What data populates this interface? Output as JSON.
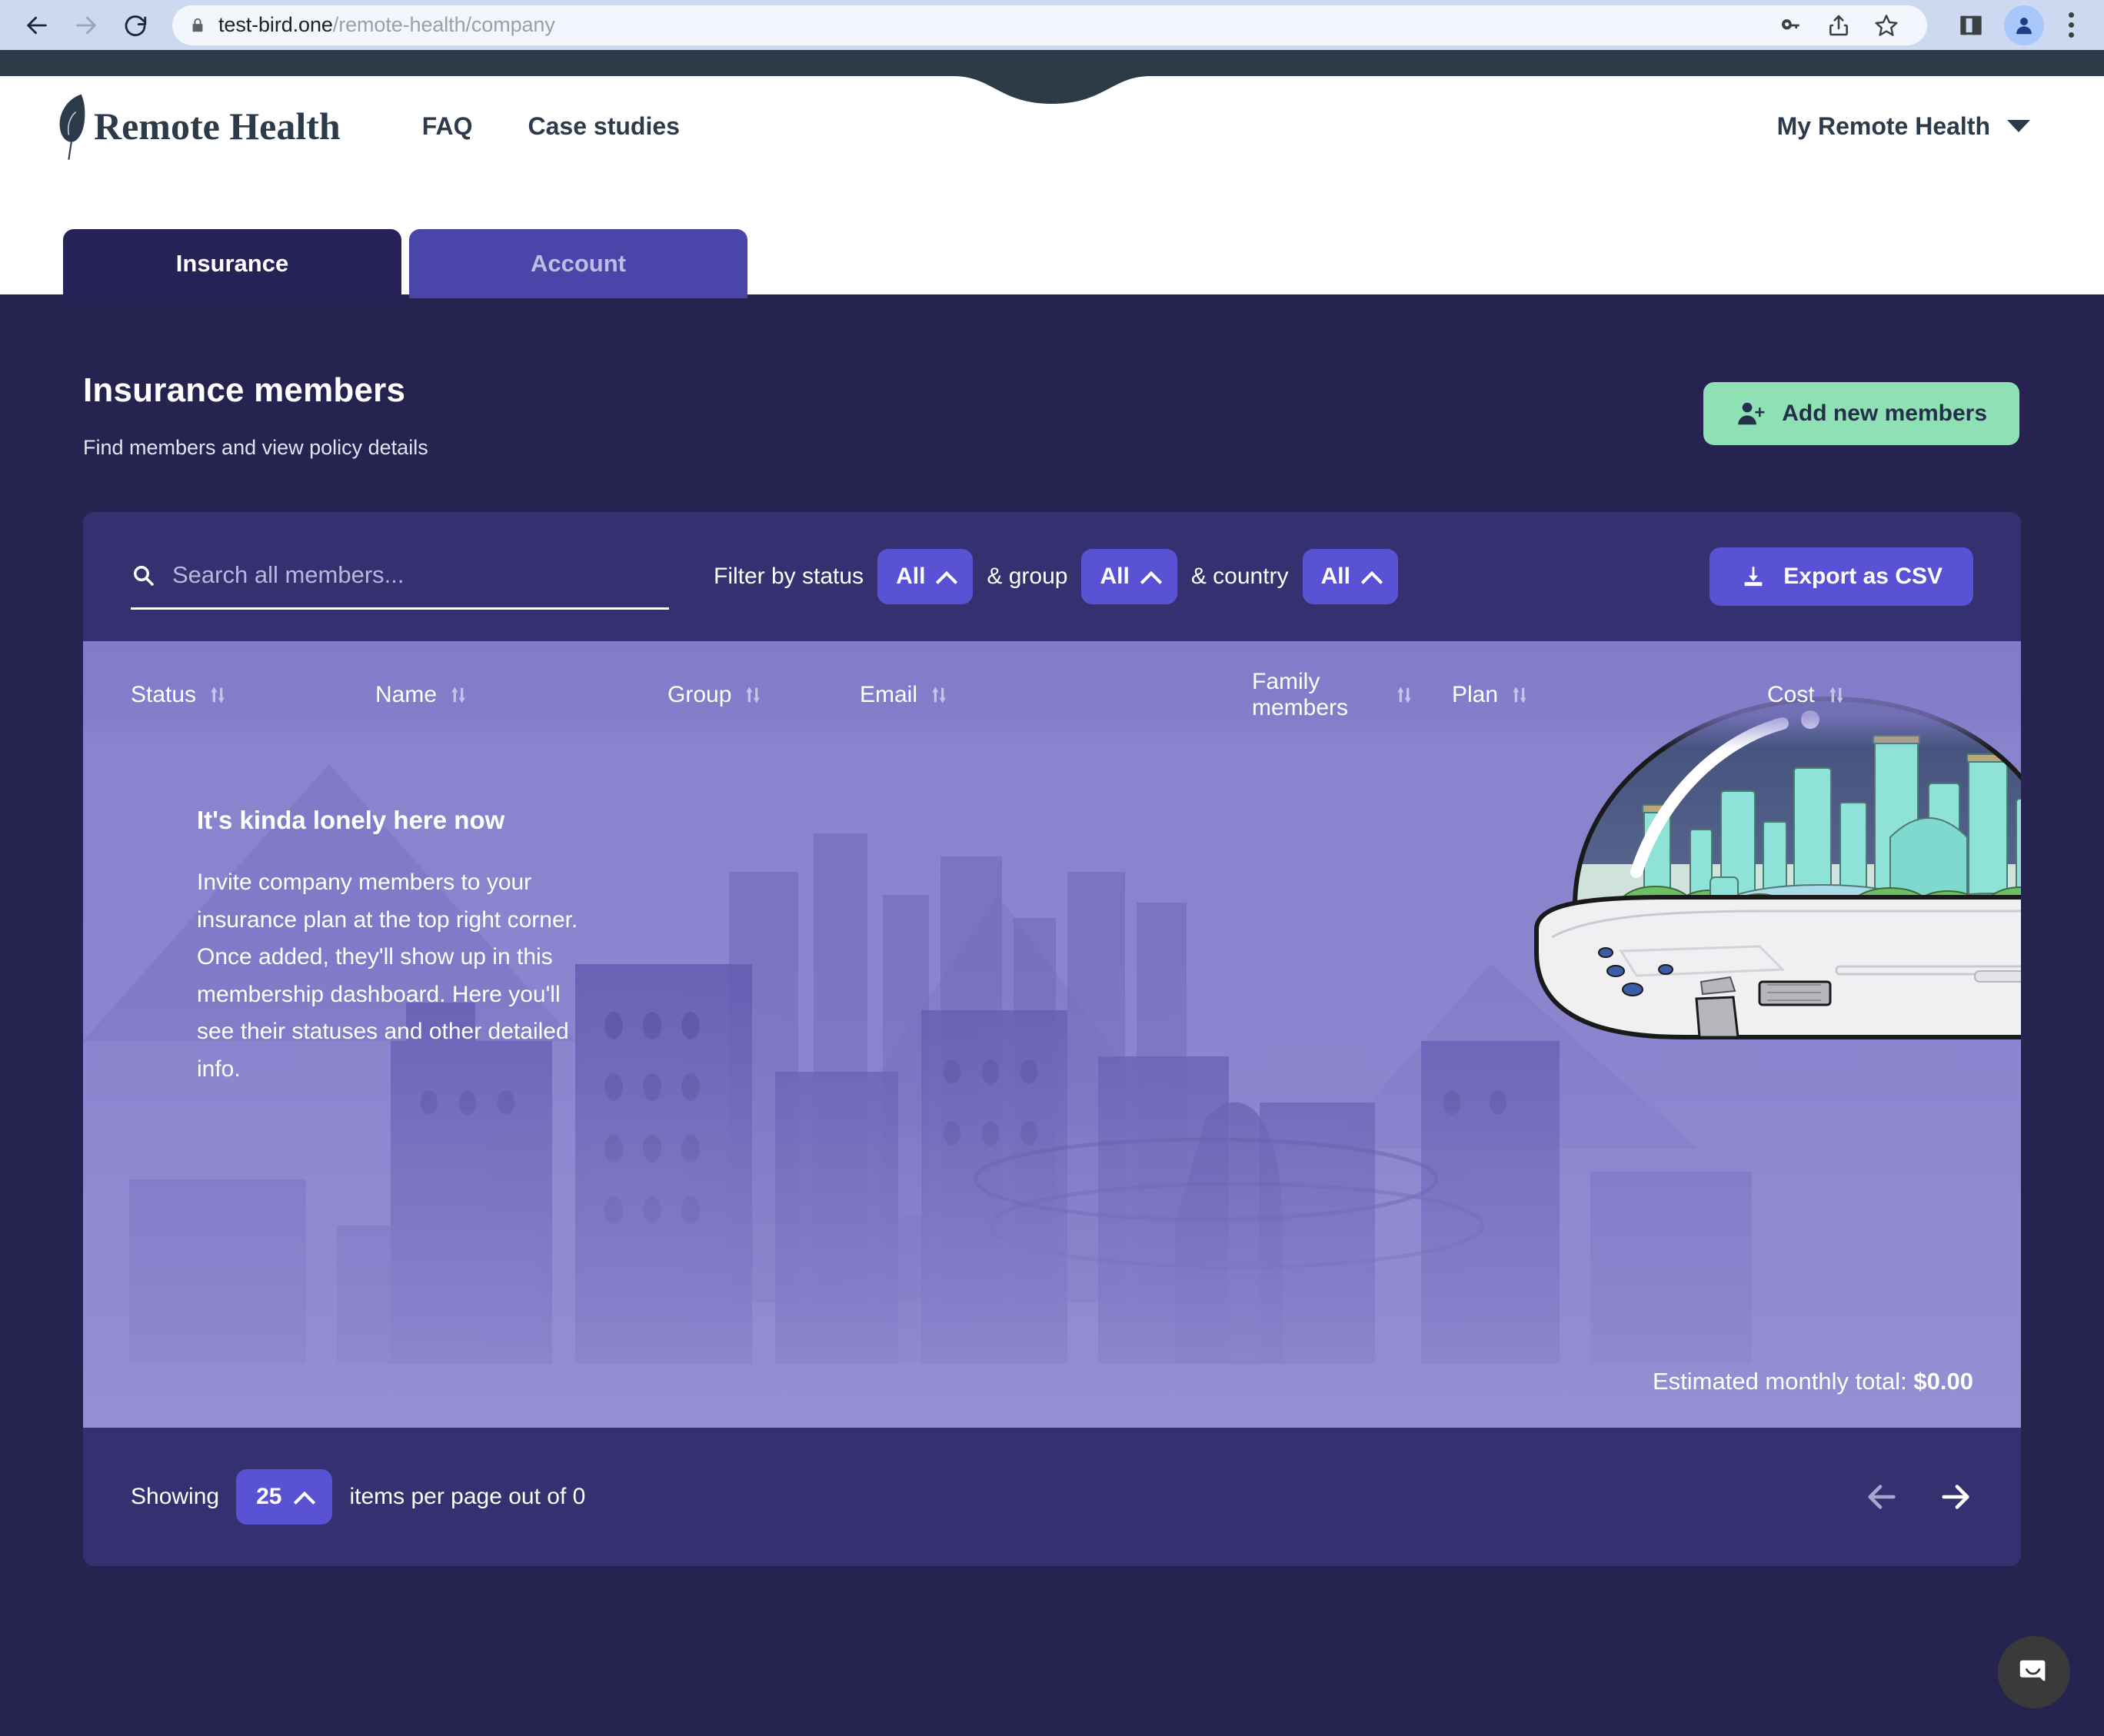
{
  "browser": {
    "url_domain": "test-bird.one",
    "url_path": "/remote-health/company",
    "back_icon": "back-arrow-icon",
    "forward_icon": "forward-arrow-icon",
    "reload_icon": "reload-icon",
    "lock_icon": "lock-icon",
    "password_icon": "key-icon",
    "share_icon": "share-icon",
    "bookmark_icon": "star-icon",
    "sidepanel_icon": "side-panel-icon",
    "profile_icon": "profile-avatar-icon",
    "menu_icon": "kebab-menu-icon"
  },
  "header": {
    "logo_icon": "feather-icon",
    "logo_text": "Remote Health",
    "nav": [
      {
        "label": "FAQ"
      },
      {
        "label": "Case studies"
      }
    ],
    "account_label": "My Remote Health",
    "account_caret_icon": "chevron-down-icon"
  },
  "tabs": [
    {
      "label": "Insurance",
      "active": true
    },
    {
      "label": "Account",
      "active": false
    }
  ],
  "page": {
    "title": "Insurance members",
    "subtitle": "Find members and view policy details",
    "add_button": {
      "label": "Add new members",
      "icon": "person-add-icon"
    }
  },
  "toolbar": {
    "search": {
      "icon": "search-icon",
      "placeholder": "Search all members...",
      "value": ""
    },
    "filters": [
      {
        "label": "Filter by status",
        "value": "All",
        "caret_icon": "chevron-up-icon"
      },
      {
        "label": "& group",
        "value": "All",
        "caret_icon": "chevron-up-icon"
      },
      {
        "label": "& country",
        "value": "All",
        "caret_icon": "chevron-up-icon"
      }
    ],
    "export_button": {
      "label": "Export as CSV",
      "icon": "download-icon"
    }
  },
  "table": {
    "columns": [
      {
        "label": "Status",
        "sort_icon": "sort-updown-icon"
      },
      {
        "label": "Name",
        "sort_icon": "sort-updown-icon"
      },
      {
        "label": "Group",
        "sort_icon": "sort-updown-icon"
      },
      {
        "label": "Email",
        "sort_icon": "sort-updown-icon"
      },
      {
        "label": "Family members",
        "sort_icon": "sort-updown-icon"
      },
      {
        "label": "Plan",
        "sort_icon": "sort-updown-icon"
      },
      {
        "label": "Cost",
        "sort_icon": "sort-updown-icon"
      }
    ],
    "rows": [],
    "empty_state": {
      "title": "It's kinda lonely here now",
      "body": "Invite company members to your insurance plan at the top right corner. Once added, they'll show up in this membership dashboard. Here you'll see their statuses and other detailed info.",
      "illustration": "ufo-dome-city-illustration"
    },
    "total_label": "Estimated monthly total:",
    "total_value": "$0.00"
  },
  "pagination": {
    "showing_label": "Showing",
    "per_page_value": "25",
    "per_page_caret_icon": "chevron-up-icon",
    "suffix_label": "items per page out of 0",
    "prev_icon": "arrow-left-icon",
    "next_icon": "arrow-right-icon"
  },
  "chat": {
    "launcher_icon": "chat-bubble-icon"
  },
  "colors": {
    "brand_dark": "#2c3a4a",
    "page_bg": "#272350",
    "card_bg": "#353070",
    "accent_purple": "#5a52d5",
    "accent_green": "#8fe0b4",
    "tab_active": "#262156",
    "tab_inactive": "#4a45a8",
    "table_header": "#827bc9"
  }
}
